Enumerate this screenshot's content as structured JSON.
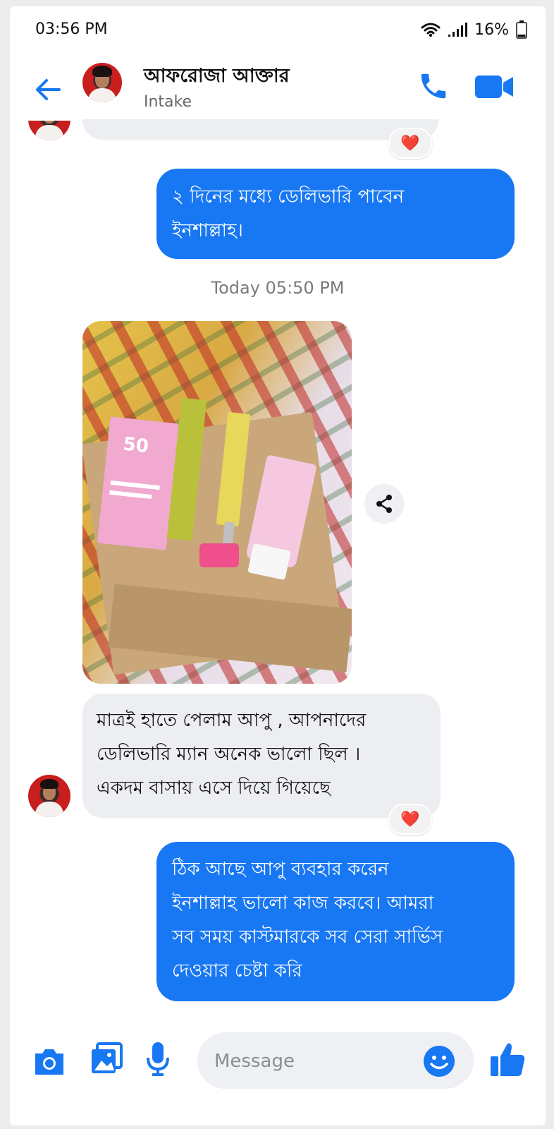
{
  "status_bar": {
    "time": "03:56 PM",
    "battery": "16%"
  },
  "header": {
    "contact_name": "আফরোজা আক্তার",
    "subtitle": "Intake"
  },
  "messages": {
    "out_1": "২ দিনের মধ্যে ডেলিভারি পাবেন\nইনশাল্লাহ।",
    "timestamp": "Today 05:50 PM",
    "in_2": "মাত্রই হাতে পেলাম আপু , আপনাদের\nডেলিভারি ম্যান অনেক ভালো ছিল ।\nএকদম বাসায় এসে দিয়ে গিয়েছে",
    "out_3": "ঠিক আছে আপু ব্যবহার করেন\nইনশাল্লাহ ভালো কাজ করবে। আমরা\nসব সময় কাস্টমারকে সব সেরা সার্ভিস\nদেওয়ার চেষ্টা করি",
    "reaction": "❤️"
  },
  "composer": {
    "placeholder": "Message"
  },
  "colors": {
    "accent": "#1877f2",
    "incoming_bubble": "#eceef1",
    "heart": "#e0242a"
  },
  "icons": [
    "back-arrow-icon",
    "phone-icon",
    "video-camera-icon",
    "share-icon",
    "camera-icon",
    "gallery-icon",
    "microphone-icon",
    "emoji-icon",
    "thumbs-up-icon",
    "wifi-icon",
    "signal-icon",
    "battery-icon"
  ]
}
